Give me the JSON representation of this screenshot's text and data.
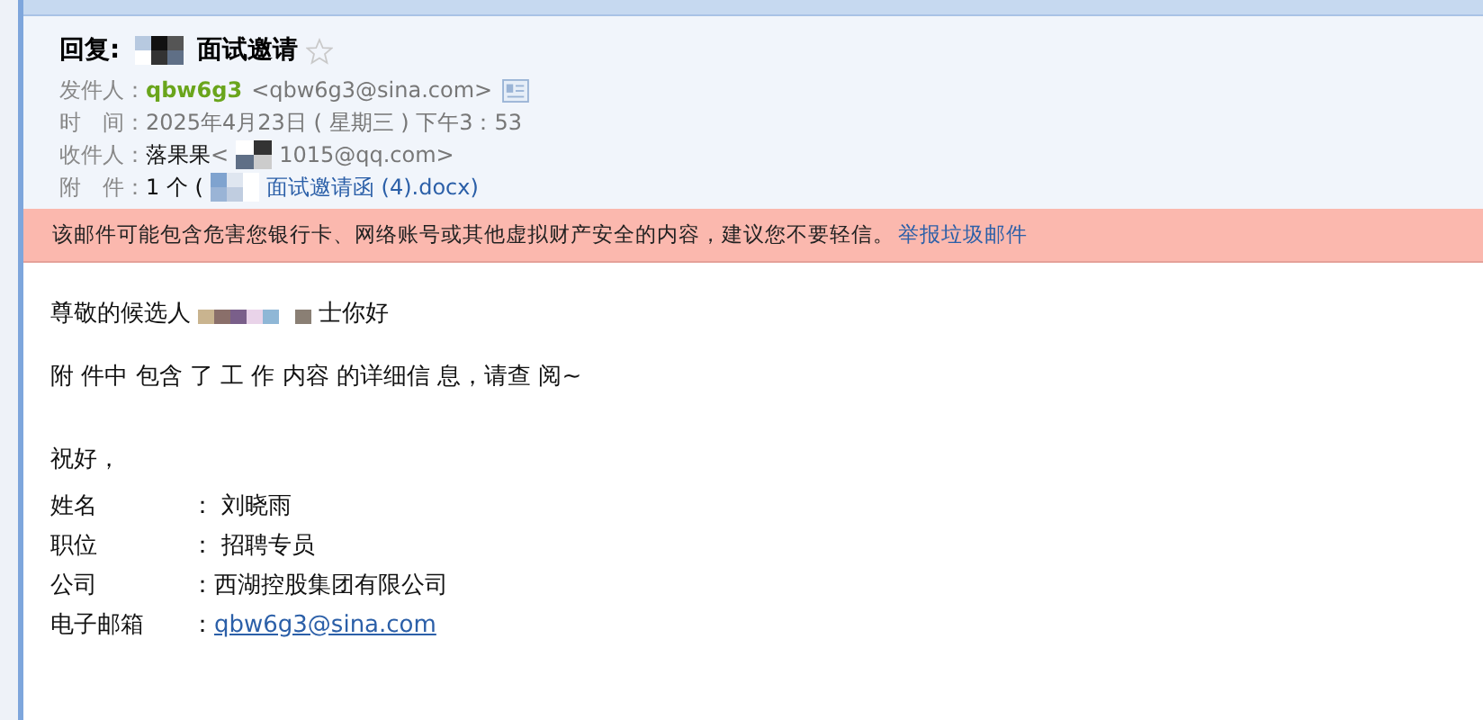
{
  "header": {
    "subject_prefix": "回复:",
    "subject": "面试邀请",
    "starred": false,
    "from": {
      "label": "发件人：",
      "name": "qbw6g3",
      "address": "<qbw6g3@sina.com>"
    },
    "time": {
      "label": "时　间：",
      "value": "2025年4月23日 ( 星期三 ) 下午3：53"
    },
    "to": {
      "label": "收件人：",
      "name": "落果果",
      "address_start": "<",
      "address_end": "1015@qq.com>"
    },
    "attachment": {
      "label": "附　件：",
      "count": "1 个 (",
      "file": "面试邀请函 (4).docx)"
    }
  },
  "warning": {
    "text": "该邮件可能包含危害您银行卡、网络账号或其他虚拟财产安全的内容，建议您不要轻信。",
    "link": "举报垃圾邮件"
  },
  "body": {
    "greeting_start": "尊敬的候选人",
    "greeting_end": "士你好",
    "paragraph": "附 件中 包含 了 工 作 内容 的详细信 息，请查 阅~",
    "closing": "祝好，",
    "signature": [
      {
        "label": "姓名",
        "value": "：  刘晓雨",
        "kind": "text"
      },
      {
        "label": "职位",
        "value": "：  招聘专员",
        "kind": "text"
      },
      {
        "label": "公司",
        "value": "：西湖控股集团有限公司",
        "kind": "text"
      },
      {
        "label": "电子邮箱",
        "value": "qbw6g3@sina.com",
        "kind": "link",
        "prefix": "："
      }
    ]
  }
}
